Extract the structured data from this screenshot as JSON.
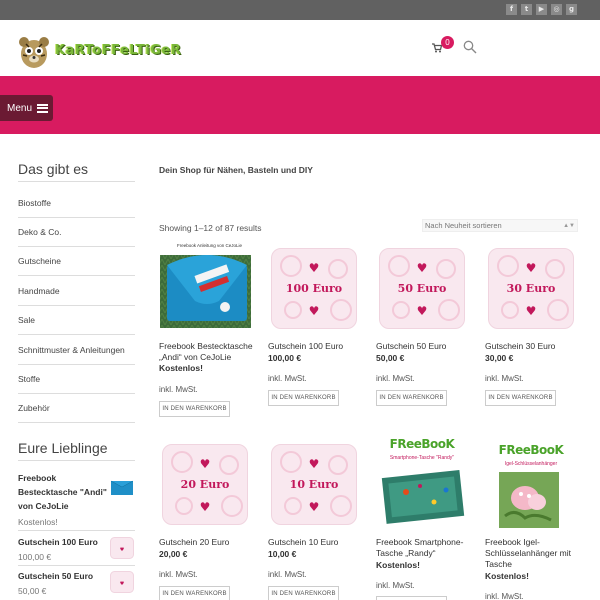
{
  "topbar": {
    "social": [
      "facebook-icon",
      "twitter-icon",
      "youtube-icon",
      "instagram-icon",
      "google-plus-icon"
    ]
  },
  "header": {
    "logo_text": "KaRToFFeLTiGeR",
    "cart_count": "0"
  },
  "menu": {
    "label": "Menu"
  },
  "sidebar": {
    "heading1": "Das gibt es",
    "categories": [
      "Biostoffe",
      "Deko & Co.",
      "Gutscheine",
      "Handmade",
      "Sale",
      "Schnittmuster & Anleitungen",
      "Stoffe",
      "Zubehör"
    ],
    "heading2": "Eure Lieblinge",
    "favorites": [
      {
        "title": "Freebook Bestecktasche \"Andi\" von CeJoLie",
        "price": "Kostenlos!"
      },
      {
        "title": "Gutschein 100 Euro",
        "price": "100,00 €"
      },
      {
        "title": "Gutschein 50 Euro",
        "price": "50,00 €"
      }
    ]
  },
  "main": {
    "intro": "Dein Shop für Nähen, Basteln und DIY",
    "showing": "Showing 1–12 of 87 results",
    "sort": "Nach Neuheit sortieren",
    "cart_button": "IN DEN WARENKORB",
    "tax": "inkl. MwSt.",
    "products": [
      {
        "title": "Freebook Bestecktasche „Andi“ von CeJoLie",
        "price": "Kostenlos!",
        "image_caption": "Freebook Anleitung von CeJoLie"
      },
      {
        "title": "Gutschein 100 Euro",
        "price": "100,00 €",
        "voucher": "100 Euro"
      },
      {
        "title": "Gutschein 50 Euro",
        "price": "50,00 €",
        "voucher": "50 Euro"
      },
      {
        "title": "Gutschein 30 Euro",
        "price": "30,00 €",
        "voucher": "30 Euro"
      },
      {
        "title": "Gutschein 20 Euro",
        "price": "20,00 €",
        "voucher": "20 Euro"
      },
      {
        "title": "Gutschein 10 Euro",
        "price": "10,00 €",
        "voucher": "10 Euro"
      },
      {
        "title": "Freebook Smartphone-Tasche „Randy“",
        "price": "Kostenlos!",
        "fb_logo": "FReeBooK",
        "fb_sub": "Smartphone-Tasche \"Randy\""
      },
      {
        "title": "Freebook Igel-Schlüsselanhänger mit Tasche",
        "price": "Kostenlos!",
        "fb_logo": "FReeBooK",
        "fb_sub": "Igel-Schlüsselanhänger"
      }
    ]
  },
  "colors": {
    "accent": "#d81b60",
    "menu_bg": "#6b1a33",
    "topbar": "#616161"
  }
}
